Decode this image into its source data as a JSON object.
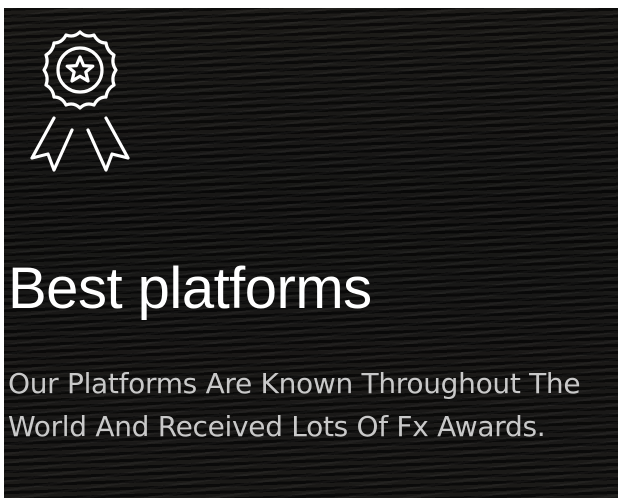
{
  "feature_card": {
    "icon": "award-ribbon-icon",
    "title": "Best platforms",
    "description": "Our Platforms Are Known Throughout The World And Received Lots Of Fx Awards.",
    "colors": {
      "background": "#141414",
      "title": "#ffffff",
      "description": "#c9c9c9",
      "icon": "#ffffff"
    }
  }
}
